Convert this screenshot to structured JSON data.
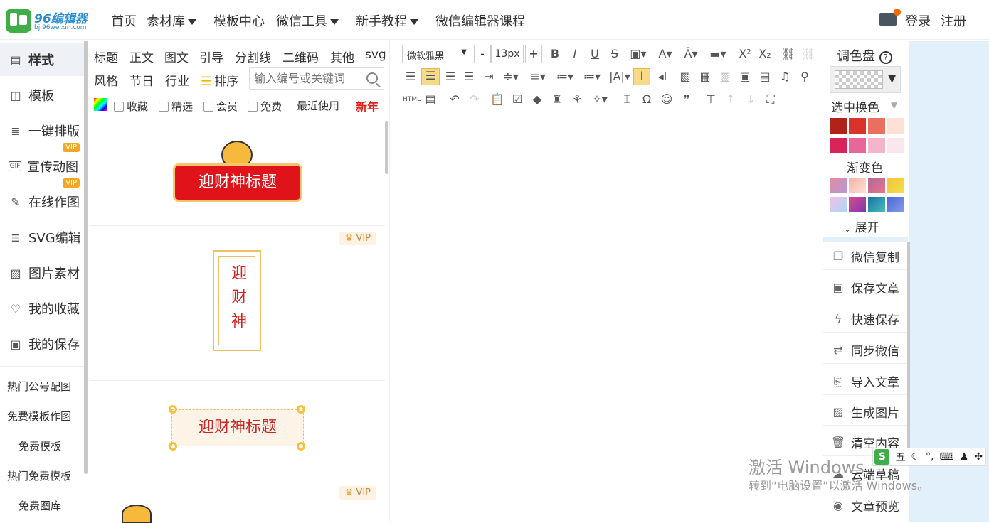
{
  "logo": {
    "title": "96编辑器",
    "subtitle": "bj.96weixin.com"
  },
  "nav": {
    "items": [
      {
        "label": "首页",
        "dropdown": false
      },
      {
        "label": "素材库",
        "dropdown": true
      },
      {
        "label": "模板中心",
        "dropdown": false
      },
      {
        "label": "微信工具",
        "dropdown": true
      },
      {
        "label": "新手教程",
        "dropdown": true
      },
      {
        "label": "微信编辑器课程",
        "dropdown": false
      }
    ],
    "login": "登录",
    "register": "注册"
  },
  "sidebar": {
    "items": [
      {
        "label": "样式",
        "icon": "layout-icon",
        "active": true
      },
      {
        "label": "模板",
        "icon": "template-icon"
      },
      {
        "label": "一键排版",
        "icon": "format-icon",
        "vip": "VIP"
      },
      {
        "label": "宣传动图",
        "icon": "gif-icon",
        "vip": "VIP"
      },
      {
        "label": "在线作图",
        "icon": "draw-icon"
      },
      {
        "label": "SVG编辑",
        "icon": "svg-icon"
      },
      {
        "label": "图片素材",
        "icon": "image-icon"
      },
      {
        "label": "我的收藏",
        "icon": "heart-icon"
      },
      {
        "label": "我的保存",
        "icon": "save-icon"
      }
    ],
    "links": [
      "热门公号配图",
      "免费模板作图",
      "免费模板",
      "热门免费模板",
      "免费图库"
    ]
  },
  "materials": {
    "categories_row1": [
      "标题",
      "正文",
      "图文",
      "引导",
      "分割线",
      "二维码",
      "其他",
      "svg"
    ],
    "categories_row2": [
      "风格",
      "节日",
      "行业"
    ],
    "sort_label": "排序",
    "search_placeholder": "输入编号或关键词",
    "filters": [
      "收藏",
      "精选",
      "会员",
      "免费"
    ],
    "recent": "最近使用",
    "new_year": "新年",
    "cards": [
      {
        "title": "迎财神标题",
        "vip": ""
      },
      {
        "title": "迎财神",
        "vip": "VIP"
      },
      {
        "title": "迎财神标题",
        "vip": ""
      },
      {
        "title": "",
        "vip": "VIP"
      }
    ]
  },
  "editor": {
    "font": "微软雅黑",
    "size": "13px",
    "minus": "-",
    "plus": "+"
  },
  "colorpanel": {
    "title": "调色盘",
    "select_replace": "选中换色",
    "gradient": "渐变色",
    "expand": "展开",
    "swatches": [
      "#b0221a",
      "#d9332b",
      "#ea6f5e",
      "#fde0d6",
      "#d9245a",
      "#e8669a",
      "#f4b5cb",
      "#fbe6ee"
    ],
    "gradients": [
      [
        "#e88aa0",
        "#b09ad6"
      ],
      [
        "#f7b2a3",
        "#fde0d6"
      ],
      [
        "#b06a9a",
        "#e8738a"
      ],
      [
        "#f5c33b",
        "#f0e04a"
      ],
      [
        "#f5c0e8",
        "#a8d8f8"
      ],
      [
        "#d94a8c",
        "#7a3ab0"
      ],
      [
        "#1e6fa8",
        "#45c2b8"
      ],
      [
        "#4a6ad8",
        "#8a9ae8"
      ]
    ]
  },
  "actions": [
    {
      "label": "微信复制",
      "icon": "copy-icon"
    },
    {
      "label": "保存文章",
      "icon": "floppy-icon"
    },
    {
      "label": "快速保存",
      "icon": "bolt-icon"
    },
    {
      "label": "同步微信",
      "icon": "sync-icon"
    },
    {
      "label": "导入文章",
      "icon": "import-icon"
    },
    {
      "label": "生成图片",
      "icon": "picture-icon"
    },
    {
      "label": "清空内容",
      "icon": "trash-icon"
    },
    {
      "label": "云端草稿",
      "icon": "cloud-icon"
    },
    {
      "label": "文章预览",
      "icon": "eye-icon"
    }
  ],
  "watermark": {
    "line1": "激活 Windows",
    "line2": "转到“电脑设置”以激活 Windows。"
  },
  "ime": {
    "mode": "五"
  }
}
